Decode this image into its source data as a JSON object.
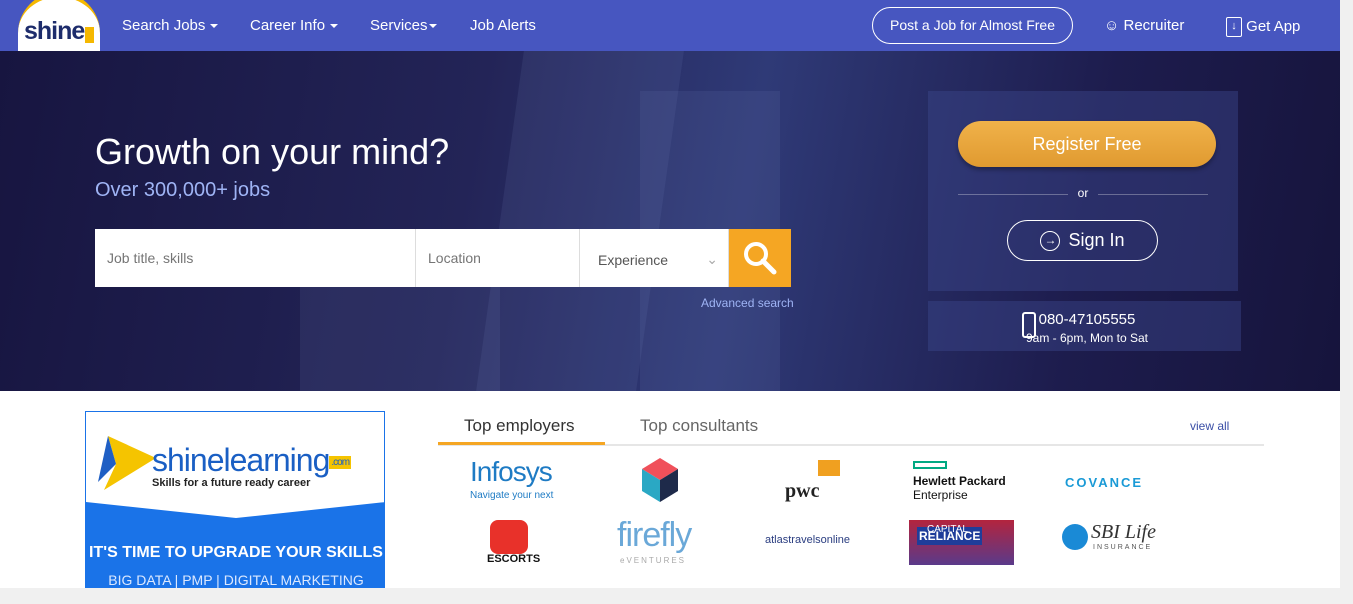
{
  "nav": {
    "logo": "shine",
    "items": [
      "Search Jobs",
      "Career Info",
      "Services",
      "Job Alerts"
    ],
    "post_job": "Post a Job for Almost Free",
    "recruiter": "Recruiter",
    "get_app": "Get App"
  },
  "hero": {
    "title": "Growth on your mind?",
    "subtitle": "Over 300,000+ jobs",
    "search": {
      "job_placeholder": "Job title, skills",
      "location_placeholder": "Location",
      "experience": "Experience"
    },
    "advanced": "Advanced search"
  },
  "panel": {
    "register": "Register Free",
    "or": "or",
    "sign_in": "Sign In",
    "phone": "080-47105555",
    "hours": "9am - 6pm, Mon to Sat"
  },
  "learning": {
    "brand": "shinelearning",
    "com": ".com",
    "tagline": "Skills for a future ready career",
    "headline": "IT'S TIME TO UPGRADE YOUR SKILLS",
    "courses": "BIG DATA | PMP | DIGITAL MARKETING"
  },
  "employers": {
    "tabs": [
      "Top employers",
      "Top consultants"
    ],
    "view_all": "view all",
    "logos": [
      "Infosys",
      "Navigate your next",
      "pwc",
      "Hewlett Packard",
      "Enterprise",
      "COVANCE",
      "ESCORTS",
      "firefly",
      "eVENTURES",
      "atlastravelsonline",
      "RELIANCE",
      "CAPITAL",
      "SBI Life",
      "INSURANCE"
    ]
  },
  "colors": {
    "nav": "#4756c0",
    "accent": "#f5a623",
    "learning_blue": "#1a73e8"
  }
}
